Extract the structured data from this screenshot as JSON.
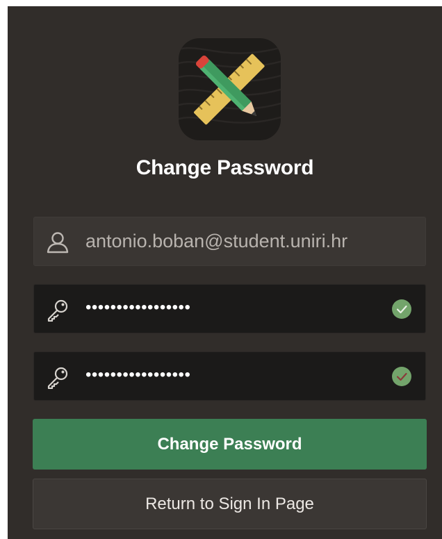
{
  "app": {
    "icon": "pencil-ruler-icon"
  },
  "page": {
    "title": "Change Password"
  },
  "form": {
    "username": {
      "icon": "user-icon",
      "value": "antonio.boban@student.uniri.hr"
    },
    "new_password": {
      "icon": "key-icon",
      "masked_value": "•••••••••••••••••",
      "status_icon": "check-circle-icon"
    },
    "confirm_password": {
      "icon": "key-icon",
      "masked_value": "•••••••••••••••••",
      "status_icon": "check-circle-icon"
    }
  },
  "buttons": {
    "change_password_label": "Change Password",
    "return_label": "Return to Sign In Page"
  },
  "colors": {
    "panel_background": "#312d2a",
    "primary_button": "#3c7f54",
    "valid_check": "#73a46b"
  }
}
